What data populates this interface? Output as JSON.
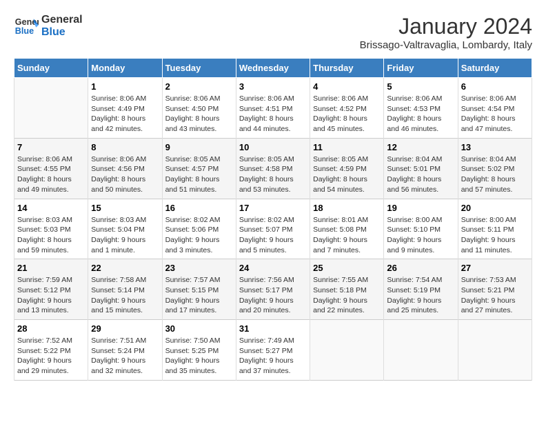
{
  "header": {
    "logo_line1": "General",
    "logo_line2": "Blue",
    "title": "January 2024",
    "subtitle": "Brissago-Valtravaglia, Lombardy, Italy"
  },
  "days_of_week": [
    "Sunday",
    "Monday",
    "Tuesday",
    "Wednesday",
    "Thursday",
    "Friday",
    "Saturday"
  ],
  "weeks": [
    [
      {
        "day": "",
        "info": ""
      },
      {
        "day": "1",
        "info": "Sunrise: 8:06 AM\nSunset: 4:49 PM\nDaylight: 8 hours\nand 42 minutes."
      },
      {
        "day": "2",
        "info": "Sunrise: 8:06 AM\nSunset: 4:50 PM\nDaylight: 8 hours\nand 43 minutes."
      },
      {
        "day": "3",
        "info": "Sunrise: 8:06 AM\nSunset: 4:51 PM\nDaylight: 8 hours\nand 44 minutes."
      },
      {
        "day": "4",
        "info": "Sunrise: 8:06 AM\nSunset: 4:52 PM\nDaylight: 8 hours\nand 45 minutes."
      },
      {
        "day": "5",
        "info": "Sunrise: 8:06 AM\nSunset: 4:53 PM\nDaylight: 8 hours\nand 46 minutes."
      },
      {
        "day": "6",
        "info": "Sunrise: 8:06 AM\nSunset: 4:54 PM\nDaylight: 8 hours\nand 47 minutes."
      }
    ],
    [
      {
        "day": "7",
        "info": "Sunrise: 8:06 AM\nSunset: 4:55 PM\nDaylight: 8 hours\nand 49 minutes."
      },
      {
        "day": "8",
        "info": "Sunrise: 8:06 AM\nSunset: 4:56 PM\nDaylight: 8 hours\nand 50 minutes."
      },
      {
        "day": "9",
        "info": "Sunrise: 8:05 AM\nSunset: 4:57 PM\nDaylight: 8 hours\nand 51 minutes."
      },
      {
        "day": "10",
        "info": "Sunrise: 8:05 AM\nSunset: 4:58 PM\nDaylight: 8 hours\nand 53 minutes."
      },
      {
        "day": "11",
        "info": "Sunrise: 8:05 AM\nSunset: 4:59 PM\nDaylight: 8 hours\nand 54 minutes."
      },
      {
        "day": "12",
        "info": "Sunrise: 8:04 AM\nSunset: 5:01 PM\nDaylight: 8 hours\nand 56 minutes."
      },
      {
        "day": "13",
        "info": "Sunrise: 8:04 AM\nSunset: 5:02 PM\nDaylight: 8 hours\nand 57 minutes."
      }
    ],
    [
      {
        "day": "14",
        "info": "Sunrise: 8:03 AM\nSunset: 5:03 PM\nDaylight: 8 hours\nand 59 minutes."
      },
      {
        "day": "15",
        "info": "Sunrise: 8:03 AM\nSunset: 5:04 PM\nDaylight: 9 hours\nand 1 minute."
      },
      {
        "day": "16",
        "info": "Sunrise: 8:02 AM\nSunset: 5:06 PM\nDaylight: 9 hours\nand 3 minutes."
      },
      {
        "day": "17",
        "info": "Sunrise: 8:02 AM\nSunset: 5:07 PM\nDaylight: 9 hours\nand 5 minutes."
      },
      {
        "day": "18",
        "info": "Sunrise: 8:01 AM\nSunset: 5:08 PM\nDaylight: 9 hours\nand 7 minutes."
      },
      {
        "day": "19",
        "info": "Sunrise: 8:00 AM\nSunset: 5:10 PM\nDaylight: 9 hours\nand 9 minutes."
      },
      {
        "day": "20",
        "info": "Sunrise: 8:00 AM\nSunset: 5:11 PM\nDaylight: 9 hours\nand 11 minutes."
      }
    ],
    [
      {
        "day": "21",
        "info": "Sunrise: 7:59 AM\nSunset: 5:12 PM\nDaylight: 9 hours\nand 13 minutes."
      },
      {
        "day": "22",
        "info": "Sunrise: 7:58 AM\nSunset: 5:14 PM\nDaylight: 9 hours\nand 15 minutes."
      },
      {
        "day": "23",
        "info": "Sunrise: 7:57 AM\nSunset: 5:15 PM\nDaylight: 9 hours\nand 17 minutes."
      },
      {
        "day": "24",
        "info": "Sunrise: 7:56 AM\nSunset: 5:17 PM\nDaylight: 9 hours\nand 20 minutes."
      },
      {
        "day": "25",
        "info": "Sunrise: 7:55 AM\nSunset: 5:18 PM\nDaylight: 9 hours\nand 22 minutes."
      },
      {
        "day": "26",
        "info": "Sunrise: 7:54 AM\nSunset: 5:19 PM\nDaylight: 9 hours\nand 25 minutes."
      },
      {
        "day": "27",
        "info": "Sunrise: 7:53 AM\nSunset: 5:21 PM\nDaylight: 9 hours\nand 27 minutes."
      }
    ],
    [
      {
        "day": "28",
        "info": "Sunrise: 7:52 AM\nSunset: 5:22 PM\nDaylight: 9 hours\nand 29 minutes."
      },
      {
        "day": "29",
        "info": "Sunrise: 7:51 AM\nSunset: 5:24 PM\nDaylight: 9 hours\nand 32 minutes."
      },
      {
        "day": "30",
        "info": "Sunrise: 7:50 AM\nSunset: 5:25 PM\nDaylight: 9 hours\nand 35 minutes."
      },
      {
        "day": "31",
        "info": "Sunrise: 7:49 AM\nSunset: 5:27 PM\nDaylight: 9 hours\nand 37 minutes."
      },
      {
        "day": "",
        "info": ""
      },
      {
        "day": "",
        "info": ""
      },
      {
        "day": "",
        "info": ""
      }
    ]
  ]
}
